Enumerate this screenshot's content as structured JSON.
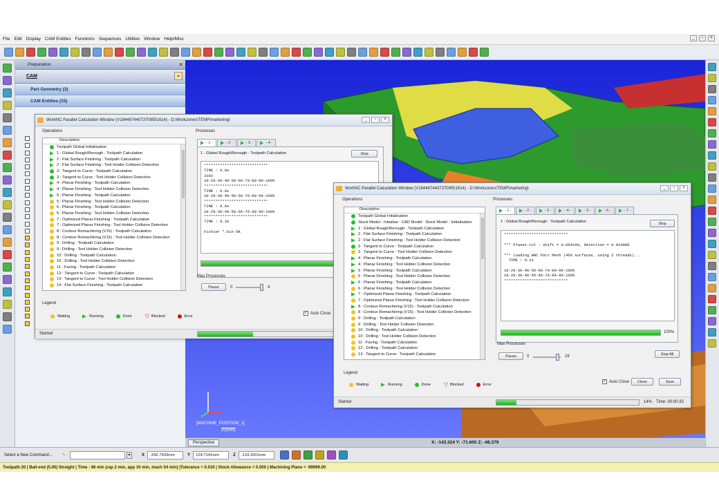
{
  "menu": [
    "File",
    "Edit",
    "Display",
    "CAM Entities",
    "Functions",
    "Sequences",
    "Utilities",
    "Window",
    "Help/Misc"
  ],
  "panel": {
    "header": "Preparation",
    "title": "CAM",
    "sections": [
      "Part Geometry (3)",
      "CAM Entities (15)"
    ]
  },
  "viewport": {
    "axis_label": "[MACHINE_POSITION_1]",
    "scale": "20(mm)",
    "view_tab": "Perspective",
    "coords": "X: -143.324   Y: -71.600   Z: -48.379"
  },
  "cmd": {
    "prompt": "Select a New Command...",
    "x": "-292.7933mm",
    "y": "124.7141mm",
    "z": "-133.2001mm",
    "x_label": "X",
    "y_label": "Y",
    "z_label": "Z"
  },
  "info": "Toolpath 20 | Ball-end (5.00) Straight | Time : 66 min (rap 2 min, app 10 min, mach 54 min) |Tolerance = 0.010 | Stock Allowance = 0.000 | Machining Plane = -99999.00",
  "win1": {
    "title": "WorkNC Parallel Calculation Window (V18446744073709551614) - D:\\Workzones\\TEMP\\marketing\\",
    "operations_label": "Operations",
    "description_label": "Description",
    "processes_label": "Processes",
    "ops": [
      {
        "s": "done",
        "t": "Toolpath Global Initialisation"
      },
      {
        "s": "run",
        "t": "1 : Global Rough/Rerough : Toolpath Calculation"
      },
      {
        "s": "run",
        "t": "2 : Flat Surface Finishing : Toolpath Calculation"
      },
      {
        "s": "run",
        "t": "2 : Flat Surface Finishing : Tool Holder Collision Detection"
      },
      {
        "s": "done",
        "t": "3 : Tangent to Curve : Toolpath Calculation"
      },
      {
        "s": "done",
        "t": "3 : Tangent to Curve : Tool Holder Collision Detection"
      },
      {
        "s": "run",
        "t": "4 : Planar Finishing : Toolpath Calculation"
      },
      {
        "s": "run",
        "t": "4 : Planar Finishing : Tool Holder Collision Detection"
      },
      {
        "s": "run",
        "t": "5 : Planar Finishing : Toolpath Calculation"
      },
      {
        "s": "wait",
        "t": "5 : Planar Finishing : Tool Holder Collision Detection"
      },
      {
        "s": "wait",
        "t": "6 : Planar Finishing : Toolpath Calculation"
      },
      {
        "s": "wait",
        "t": "6 : Planar Finishing : Tool Holder Collision Detection"
      },
      {
        "s": "wait",
        "t": "7 : Optimized Planar Finishing : Toolpath Calculation"
      },
      {
        "s": "wait",
        "t": "7 : Optimized Planar Finishing : Tool Holder Collision Detection"
      },
      {
        "s": "wait",
        "t": "8 : Contour Remachining (V15) : Toolpath Calculation"
      },
      {
        "s": "wait",
        "t": "8 : Contour Remachining (V15) : Tool Holder Collision Detection"
      },
      {
        "s": "wait",
        "t": "9 : Drilling : Toolpath Calculation"
      },
      {
        "s": "wait",
        "t": "9 : Drilling : Tool Holder Collision Detection"
      },
      {
        "s": "wait",
        "t": "10 : Drilling : Toolpath Calculation"
      },
      {
        "s": "wait",
        "t": "10 : Drilling : Tool Holder Collision Detection"
      },
      {
        "s": "wait",
        "t": "11 : Facing : Toolpath Calculation"
      },
      {
        "s": "wait",
        "t": "13 : Tangent to Curve : Toolpath Calculation"
      },
      {
        "s": "wait",
        "t": "13 : Tangent to Curve : Tool Holder Collision Detection"
      },
      {
        "s": "wait",
        "t": "14 : Flat Surface Finishing : Toolpath Calculation"
      }
    ],
    "tabs": [
      "- 1 -",
      "- 2 -",
      "- 3 -",
      "- 4 -"
    ],
    "process_name": "1 : Global Rough/Rerough : Toolpath Calculation",
    "stop": "Stop",
    "console": [
      "****************************",
      "TIME : 0.0s",
      "3192",
      "10-20-30-40-50-60-70-80-90-100%",
      "****************************",
      "TIME : 0.0s",
      "10-20-30-40-50-60-70-80-90-100%",
      "****************************",
      "TIME : 0.0s",
      "10-20-30-40-50-60-70-80-90-100%",
      "****************************",
      "TIME : 0.3s",
      "",
      "Fichier *.bin OK"
    ],
    "progress": 1.0,
    "max_label": "Max Processes",
    "pause": "Pause",
    "min": "0",
    "max": "4",
    "slider": 1.0,
    "legend_label": "Legend",
    "legend": [
      "Waiting",
      "Running",
      "Done",
      "Blocked",
      "Error"
    ],
    "autoclose": "Auto Close",
    "status": "Started",
    "status_progress": 0.3
  },
  "win2": {
    "title": "WorkNC Parallel Calculation Window (V18446744073709551614) - D:\\Workzones\\TEMP\\marketing\\",
    "operations_label": "Operations",
    "description_label": "Description",
    "processes_label": "Processes",
    "ops": [
      {
        "s": "done",
        "t": "Toolpath Global Initialisation"
      },
      {
        "s": "done",
        "t": "Stock Model - Initialise : CAD Model : Stock Model - Initialisation"
      },
      {
        "s": "run",
        "t": "1 : Global Rough/Rerough : Toolpath Calculation"
      },
      {
        "s": "run",
        "t": "2 : Flat Surface Finishing : Toolpath Calculation"
      },
      {
        "s": "run",
        "t": "2 : Flat Surface Finishing : Tool Holder Collision Detection"
      },
      {
        "s": "done",
        "t": "3 : Tangent to Curve : Toolpath Calculation"
      },
      {
        "s": "wait",
        "t": "3 : Tangent to Curve : Tool Holder Collision Detection"
      },
      {
        "s": "run",
        "t": "4 : Planar Finishing : Toolpath Calculation"
      },
      {
        "s": "run",
        "t": "4 : Planar Finishing : Tool Holder Collision Detection"
      },
      {
        "s": "run",
        "t": "5 : Planar Finishing : Toolpath Calculation"
      },
      {
        "s": "wait",
        "t": "5 : Planar Finishing : Tool Holder Collision Detection"
      },
      {
        "s": "run",
        "t": "6 : Planar Finishing : Toolpath Calculation"
      },
      {
        "s": "wait",
        "t": "6 : Planar Finishing : Tool Holder Collision Detection"
      },
      {
        "s": "run",
        "t": "7 : Optimized Planar Finishing : Toolpath Calculation"
      },
      {
        "s": "wait",
        "t": "7 : Optimized Planar Finishing : Tool Holder Collision Detection"
      },
      {
        "s": "run",
        "t": "8 : Contour Remachining (V15) : Toolpath Calculation"
      },
      {
        "s": "wait",
        "t": "8 : Contour Remachining (V15) : Tool Holder Collision Detection"
      },
      {
        "s": "wait",
        "t": "9 : Drilling : Toolpath Calculation"
      },
      {
        "s": "wait",
        "t": "9 : Drilling : Tool Holder Collision Detection"
      },
      {
        "s": "wait",
        "t": "10 : Drilling : Toolpath Calculation"
      },
      {
        "s": "wait",
        "t": "10 : Drilling : Tool Holder Collision Detection"
      },
      {
        "s": "wait",
        "t": "11 : Facing : Toolpath Calculation"
      },
      {
        "s": "wait",
        "t": "12 : Drilling : Toolpath Calculation"
      },
      {
        "s": "wait",
        "t": "13 : Tangent to Curve : Toolpath Calculation"
      }
    ],
    "tabs": [
      "- 1 -",
      "- 2 -",
      "- 3 -",
      "- 4 -",
      "- 5 -",
      "- 6 -",
      "- 7 -"
    ],
    "process_name": "1 : Global Rough/Rerough : Toolpath Calculation",
    "stop": "Stop",
    "console": [
      "****************************",
      "",
      "*** Planes tol : shift = 0.004100, detection = 0.010000",
      "",
      "*** Loading WNC Part Mesh (466 surfaces, using 2 threads)...",
      "  TIME : 0.2s",
      "",
      "10-20-30-40-50-60-70-80-90-100%",
      "10-20-30-40-50-60-70-80-90-100%",
      "****************************"
    ],
    "progress": 1.0,
    "progress_text": "100%",
    "max_label": "Max Processes",
    "pause": "Pause",
    "min": "0",
    "max": "16",
    "slider": 0.95,
    "stop_all": "Stop All",
    "legend_label": "Legend",
    "legend": [
      "Waiting",
      "Running",
      "Done",
      "Blocked",
      "Error"
    ],
    "autoclose": "Auto Close",
    "close": "Close",
    "save": "Save",
    "status": "Started",
    "status_progress": 0.14,
    "status_pct": "14%",
    "status_time": "Time: 00:00:33"
  },
  "colors": {
    "wait": "#f0c419",
    "run": "#2db52d",
    "done": "#22c022",
    "blocked": "#e03030",
    "error": "#d01010"
  }
}
